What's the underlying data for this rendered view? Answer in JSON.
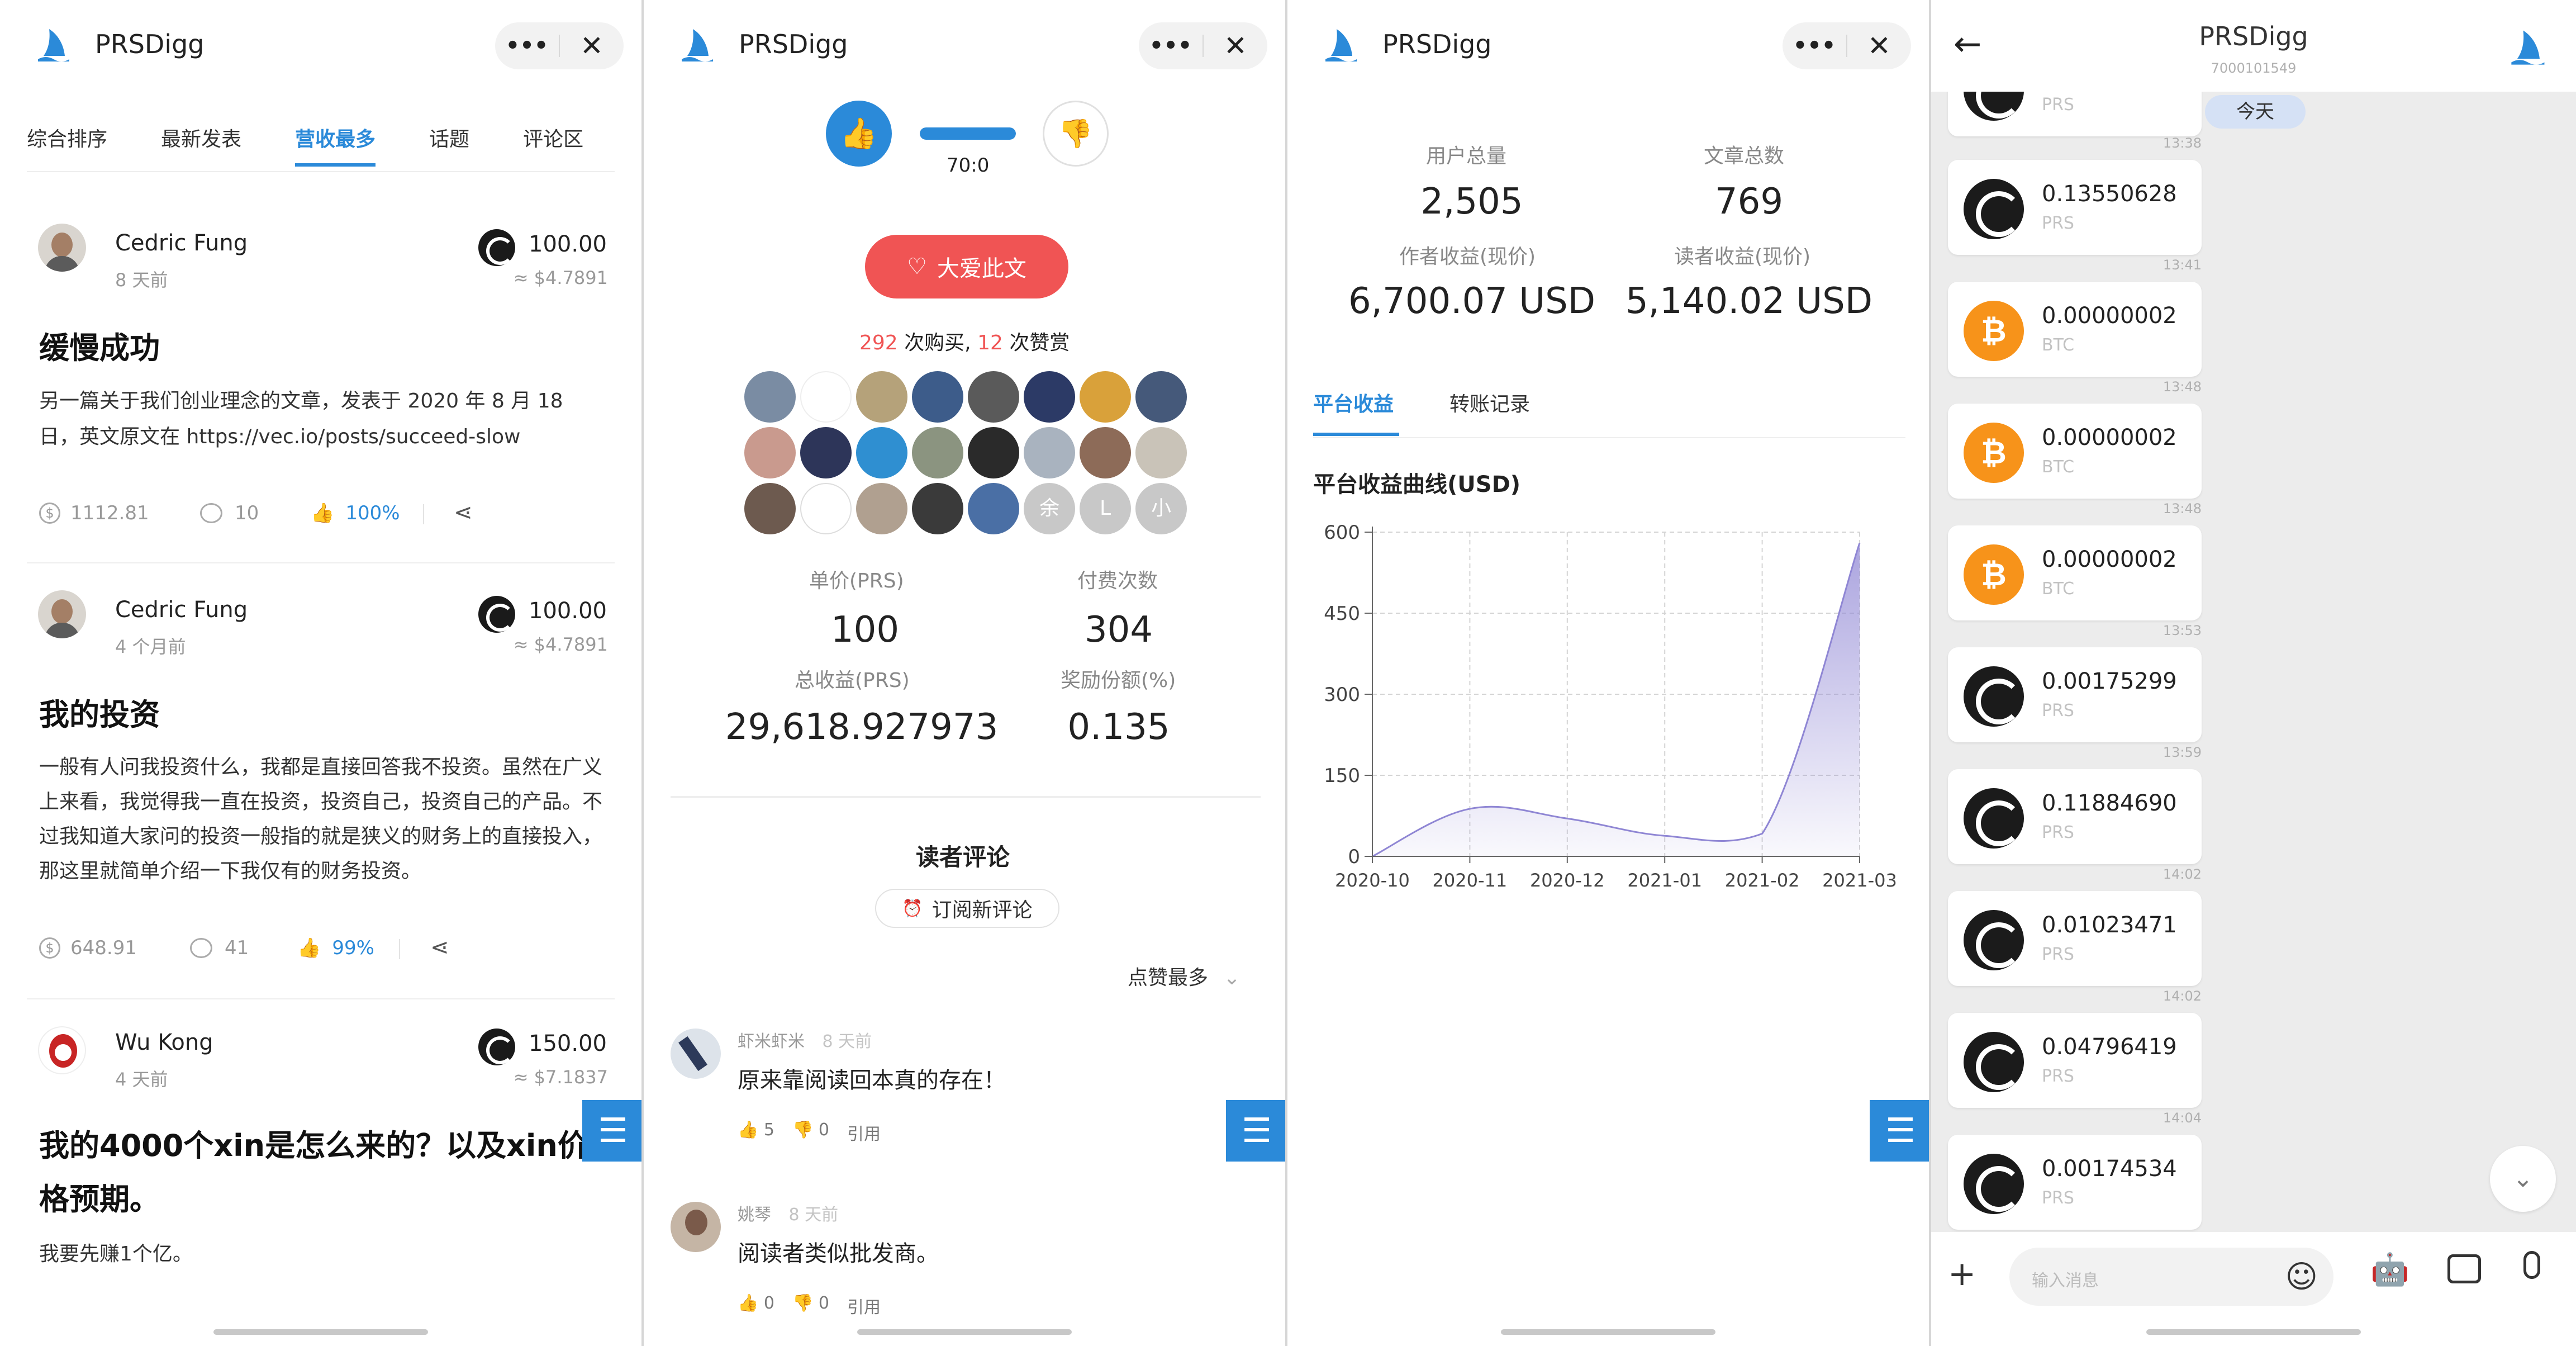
{
  "brand": {
    "blue": "#2b8ad9",
    "red": "#f05454",
    "prs_icon_color": "#1b1b1b",
    "btc_icon_color": "#f7931a"
  },
  "panel1": {
    "app_title": "PRSDigg",
    "tabs": [
      "综合排序",
      "最新发表",
      "营收最多",
      "话题",
      "评论区"
    ],
    "active_tab": "营收最多",
    "articles": [
      {
        "author": "Cedric Fung",
        "time": "8 天前",
        "price": "100.00",
        "price_usd": "≈ $4.7891",
        "title": "缓慢成功",
        "body": "另一篇关于我们创业理念的文章，发表于 2020 年 8 月 18 日，英文原文在 https://vec.io/posts/succeed-slow",
        "revenue": "1112.81",
        "comments": "10",
        "likes": "100%"
      },
      {
        "author": "Cedric Fung",
        "time": "4 个月前",
        "price": "100.00",
        "price_usd": "≈ $4.7891",
        "title": "我的投资",
        "body": "一般有人问我投资什么，我都是直接回答我不投资。虽然在广义上来看，我觉得我一直在投资，投资自己，投资自己的产品。不过我知道大家问的投资一般指的就是狭义的财务上的直接投入，那这里就简单介绍一下我仅有的财务投资。",
        "revenue": "648.91",
        "comments": "41",
        "likes": "99%"
      },
      {
        "author": "Wu Kong",
        "time": "4 天前",
        "price": "150.00",
        "price_usd": "≈ $7.1837",
        "title": "我的4000个xin是怎么来的？以及xin价格预期。",
        "body": "我要先赚1个亿。"
      }
    ]
  },
  "panel2": {
    "app_title": "PRSDigg",
    "vote_ratio": "70:0",
    "vote_up_fraction": 1.0,
    "love_button": "大爱此文",
    "purchases_count": "292",
    "purchases_label": "次购买,",
    "appreciations_count": "12",
    "appreciations_label": "次赞赏",
    "avatar_text": [
      "余",
      "L",
      "小"
    ],
    "stats": [
      {
        "label": "单价(PRS)",
        "value": "100"
      },
      {
        "label": "付费次数",
        "value": "304"
      },
      {
        "label": "总收益(PRS)",
        "value": "29,618.927973"
      },
      {
        "label": "奖励份额(%)",
        "value": "0.135"
      }
    ],
    "comments_title": "读者评论",
    "subscribe_button": "订阅新评论",
    "sort_label": "点赞最多",
    "comments": [
      {
        "author": "虾米虾米",
        "time": "8 天前",
        "text": "原来靠阅读回本真的存在！",
        "likes": "5",
        "dislikes": "0",
        "quote": "引用"
      },
      {
        "author": "姚琴",
        "time": "8 天前",
        "text": "阅读者类似批发商。",
        "likes": "0",
        "dislikes": "0",
        "quote": "引用"
      }
    ]
  },
  "panel3": {
    "app_title": "PRSDigg",
    "stats": [
      {
        "label": "用户总量",
        "value": "2,505"
      },
      {
        "label": "文章总数",
        "value": "769"
      },
      {
        "label": "作者收益(现价)",
        "value": "6,700.07 USD"
      },
      {
        "label": "读者收益(现价)",
        "value": "5,140.02 USD"
      }
    ],
    "tabs": [
      "平台收益",
      "转账记录"
    ],
    "active_tab": "平台收益"
  },
  "chart_data": {
    "type": "area",
    "title": "平台收益曲线(USD)",
    "x": [
      "2020-10",
      "2020-11",
      "2020-12",
      "2021-01",
      "2021-02",
      "2021-03"
    ],
    "y": [
      0,
      88,
      70,
      38,
      42,
      580
    ],
    "ylim": [
      0,
      600
    ],
    "yticks": [
      0,
      150,
      300,
      450,
      600
    ],
    "grid": true,
    "color": "#8f86d4"
  },
  "panel4": {
    "title": "PRSDigg",
    "subtitle": "7000101549",
    "today_label": "今天",
    "top_partial_currency": "PRS",
    "messages": [
      {
        "amount": "0.13550628",
        "currency": "PRS",
        "time": "13:38",
        "icon": "prs-icon"
      },
      {
        "amount": "0.00000002",
        "currency": "BTC",
        "time": "13:41",
        "icon": "btc-icon"
      },
      {
        "amount": "0.00000002",
        "currency": "BTC",
        "time": "13:48",
        "icon": "btc-icon"
      },
      {
        "amount": "0.00000002",
        "currency": "BTC",
        "time": "13:48",
        "icon": "btc-icon"
      },
      {
        "amount": "0.00175299",
        "currency": "PRS",
        "time": "13:53",
        "icon": "prs-icon"
      },
      {
        "amount": "0.11884690",
        "currency": "PRS",
        "time": "13:59",
        "icon": "prs-icon"
      },
      {
        "amount": "0.01023471",
        "currency": "PRS",
        "time": "14:02",
        "icon": "prs-icon"
      },
      {
        "amount": "0.04796419",
        "currency": "PRS",
        "time": "14:02",
        "icon": "prs-icon"
      },
      {
        "amount": "0.00174534",
        "currency": "PRS",
        "time": "14:04",
        "icon": "prs-icon"
      }
    ],
    "input_placeholder": "输入消息"
  }
}
